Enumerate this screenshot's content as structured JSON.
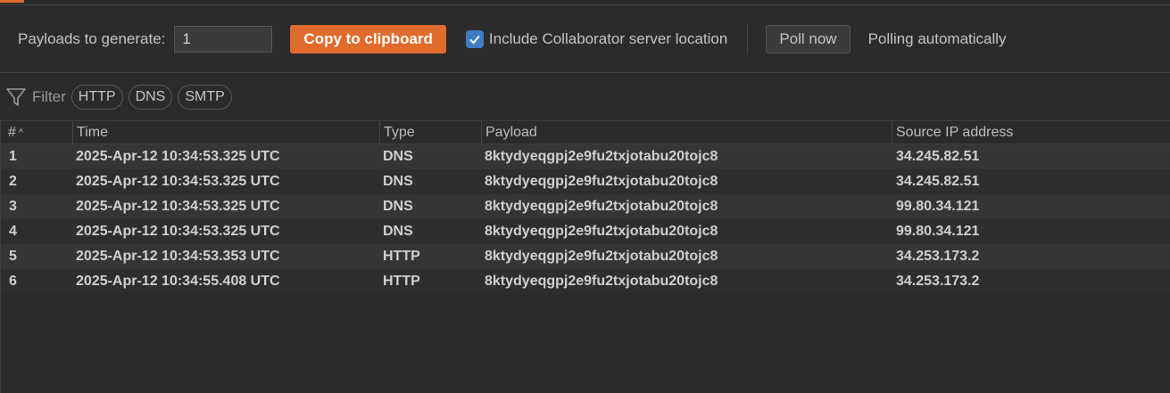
{
  "toolbar": {
    "payloads_label": "Payloads to generate:",
    "payloads_value": "1",
    "copy_label": "Copy to clipboard",
    "include_label": "Include Collaborator server location",
    "include_checked": true,
    "poll_label": "Poll now",
    "status_text": "Polling automatically",
    "accent_color": "#e06b2d",
    "checkbox_color": "#3f7cc4"
  },
  "filter": {
    "label": "Filter",
    "pills": [
      "HTTP",
      "DNS",
      "SMTP"
    ]
  },
  "table": {
    "columns": [
      "#",
      "Time",
      "Type",
      "Payload",
      "Source IP address"
    ],
    "sort": {
      "column": "#",
      "direction": "ascending"
    },
    "rows": [
      {
        "num": "1",
        "time": "2025-Apr-12 10:34:53.325 UTC",
        "type": "DNS",
        "payload": "8ktydyeqgpj2e9fu2txjotabu20tojc8",
        "ip": "34.245.82.51"
      },
      {
        "num": "2",
        "time": "2025-Apr-12 10:34:53.325 UTC",
        "type": "DNS",
        "payload": "8ktydyeqgpj2e9fu2txjotabu20tojc8",
        "ip": "34.245.82.51"
      },
      {
        "num": "3",
        "time": "2025-Apr-12 10:34:53.325 UTC",
        "type": "DNS",
        "payload": "8ktydyeqgpj2e9fu2txjotabu20tojc8",
        "ip": "99.80.34.121"
      },
      {
        "num": "4",
        "time": "2025-Apr-12 10:34:53.325 UTC",
        "type": "DNS",
        "payload": "8ktydyeqgpj2e9fu2txjotabu20tojc8",
        "ip": "99.80.34.121"
      },
      {
        "num": "5",
        "time": "2025-Apr-12 10:34:53.353 UTC",
        "type": "HTTP",
        "payload": "8ktydyeqgpj2e9fu2txjotabu20tojc8",
        "ip": "34.253.173.2"
      },
      {
        "num": "6",
        "time": "2025-Apr-12 10:34:55.408 UTC",
        "type": "HTTP",
        "payload": "8ktydyeqgpj2e9fu2txjotabu20tojc8",
        "ip": "34.253.173.2"
      }
    ]
  }
}
